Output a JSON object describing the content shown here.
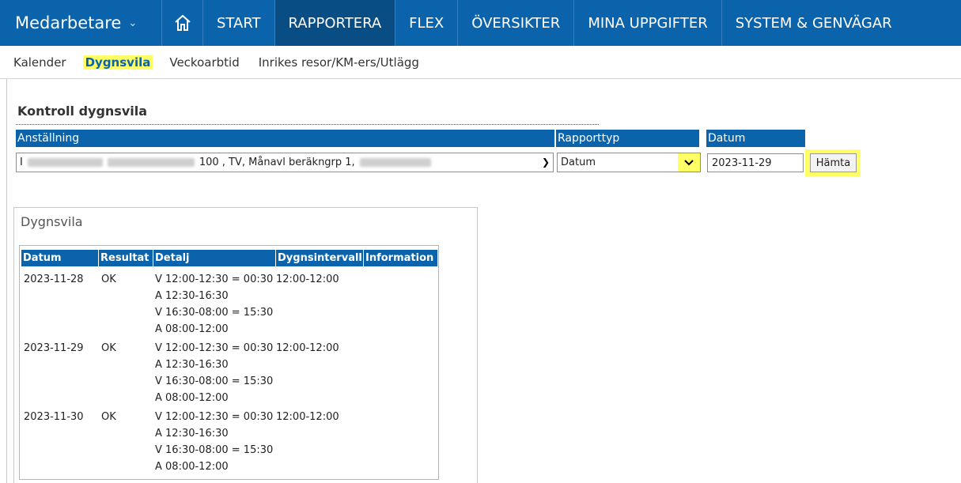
{
  "topnav": {
    "brand": "Medarbetare",
    "items": [
      "START",
      "RAPPORTERA",
      "FLEX",
      "ÖVERSIKTER",
      "MINA UPPGIFTER",
      "SYSTEM & GENVÄGAR"
    ],
    "active": "RAPPORTERA"
  },
  "subnav": {
    "items": [
      "Kalender",
      "Dygnsvila",
      "Veckoarbtid",
      "Inrikes resor/KM-ers/Utlägg"
    ],
    "active": "Dygnsvila"
  },
  "page_title": "Kontroll dygnsvila",
  "form": {
    "anstallning_label": "Anställning",
    "anstallning_prefix": "I",
    "anstallning_value": "100 , TV, Månavl beräkngrp 1,",
    "rapporttyp_label": "Rapporttyp",
    "rapporttyp_value": "Datum",
    "datum_label": "Datum",
    "datum_value": "2023-11-29",
    "button": "Hämta"
  },
  "panel_title": "Dygnsvila",
  "table": {
    "headers": [
      "Datum",
      "Resultat",
      "Detalj",
      "Dygnsintervall",
      "Information"
    ],
    "rows": [
      {
        "datum": "2023-11-28",
        "resultat": "OK",
        "detalj": [
          "V 12:00-12:30 = 00:30",
          "A 12:30-16:30",
          "V 16:30-08:00 = 15:30",
          "A 08:00-12:00"
        ],
        "intervall": "12:00-12:00",
        "information": ""
      },
      {
        "datum": "2023-11-29",
        "resultat": "OK",
        "detalj": [
          "V 12:00-12:30 = 00:30",
          "A 12:30-16:30",
          "V 16:30-08:00 = 15:30",
          "A 08:00-12:00"
        ],
        "intervall": "12:00-12:00",
        "information": ""
      },
      {
        "datum": "2023-11-30",
        "resultat": "OK",
        "detalj": [
          "V 12:00-12:30 = 00:30",
          "A 12:30-16:30",
          "V 16:30-08:00 = 15:30",
          "A 08:00-12:00"
        ],
        "intervall": "12:00-12:00",
        "information": ""
      }
    ]
  },
  "colors": {
    "primary": "#0b64ab",
    "active_nav": "#084d84",
    "highlight": "#ffff66"
  }
}
